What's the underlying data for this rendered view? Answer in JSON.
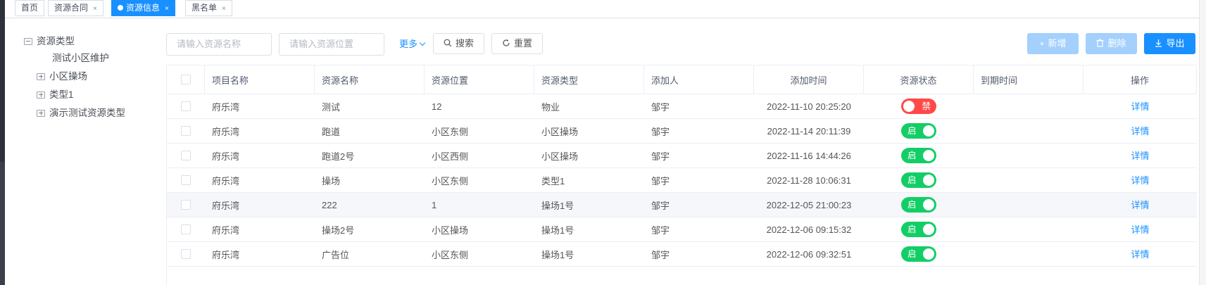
{
  "tabs": [
    {
      "label": "首页",
      "closable": false,
      "active": false
    },
    {
      "label": "资源合同",
      "closable": true,
      "active": false
    },
    {
      "label": "资源信息",
      "closable": true,
      "active": true
    },
    {
      "label": "黑名单",
      "closable": true,
      "active": false
    }
  ],
  "tab_close_glyph": "×",
  "tree": [
    {
      "label": "资源类型",
      "icon": "minus-square-icon"
    },
    {
      "label": "测试小区维护",
      "icon": ""
    },
    {
      "label": "小区操场",
      "icon": "plus-square-icon"
    },
    {
      "label": "类型1",
      "icon": "plus-square-icon"
    },
    {
      "label": "演示测试资源类型",
      "icon": "plus-square-icon"
    }
  ],
  "filters": {
    "name_placeholder": "请输入资源名称",
    "location_placeholder": "请输入资源位置",
    "more_label": "更多",
    "search_label": "搜索",
    "reset_label": "重置"
  },
  "actions": {
    "add_label": "新增",
    "delete_label": "删除",
    "export_label": "导出"
  },
  "table": {
    "columns": [
      "项目名称",
      "资源名称",
      "资源位置",
      "资源类型",
      "添加人",
      "添加时间",
      "资源状态",
      "到期时间",
      "操作"
    ],
    "rows": [
      {
        "project": "府乐湾",
        "name": "测试",
        "location": "12",
        "type": "物业",
        "adder": "邹宇",
        "time": "2022-11-10 20:25:20",
        "status_on": false,
        "status_label": "禁",
        "expire": "",
        "action": "详情"
      },
      {
        "project": "府乐湾",
        "name": "跑道",
        "location": "小区东侧",
        "type": "小区操场",
        "adder": "邹宇",
        "time": "2022-11-14 20:11:39",
        "status_on": true,
        "status_label": "启",
        "expire": "",
        "action": "详情"
      },
      {
        "project": "府乐湾",
        "name": "跑道2号",
        "location": "小区西侧",
        "type": "小区操场",
        "adder": "邹宇",
        "time": "2022-11-16 14:44:26",
        "status_on": true,
        "status_label": "启",
        "expire": "",
        "action": "详情"
      },
      {
        "project": "府乐湾",
        "name": "操场",
        "location": "小区东侧",
        "type": "类型1",
        "adder": "邹宇",
        "time": "2022-11-28 10:06:31",
        "status_on": true,
        "status_label": "启",
        "expire": "",
        "action": "详情"
      },
      {
        "project": "府乐湾",
        "name": "222",
        "location": "1",
        "type": "操场1号",
        "adder": "邹宇",
        "time": "2022-12-05 21:00:23",
        "status_on": true,
        "status_label": "启",
        "expire": "",
        "action": "详情"
      },
      {
        "project": "府乐湾",
        "name": "操场2号",
        "location": "小区操场",
        "type": "操场1号",
        "adder": "邹宇",
        "time": "2022-12-06 09:15:32",
        "status_on": true,
        "status_label": "启",
        "expire": "",
        "action": "详情"
      },
      {
        "project": "府乐湾",
        "name": "广告位",
        "location": "小区东侧",
        "type": "操场1号",
        "adder": "邹宇",
        "time": "2022-12-06 09:32:51",
        "status_on": true,
        "status_label": "启",
        "expire": "",
        "action": "详情"
      }
    ]
  },
  "colors": {
    "primary": "#1890ff",
    "switch_on": "#13ce66",
    "switch_off": "#ff4949",
    "disabled_button": "#a3d0fd"
  }
}
